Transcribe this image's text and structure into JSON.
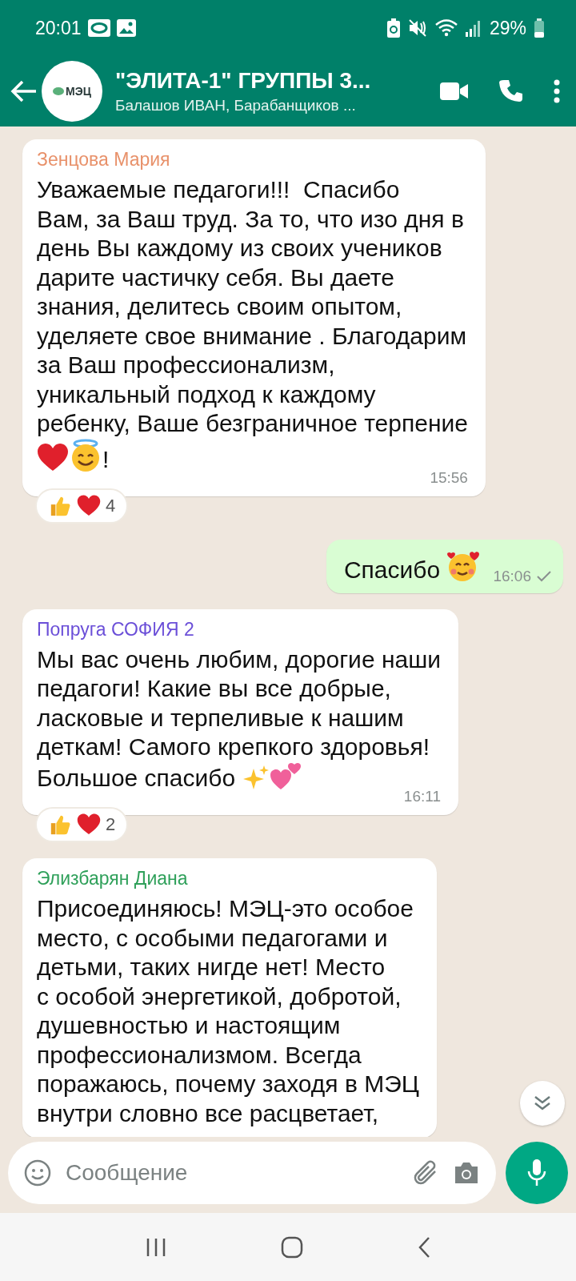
{
  "status_bar": {
    "time": "20:01",
    "battery": "29%"
  },
  "header": {
    "avatar_text": "МЭЦ",
    "title": "\"ЭЛИТА-1\" ГРУППЫ 3...",
    "subtitle": "Балашов ИВАН, Барабанщиков ..."
  },
  "messages": [
    {
      "kind": "incoming",
      "sender": "Зенцова Мария",
      "color": "#e8916a",
      "text": "Уважаемые педагоги!!!  Спасибо\nВам, за Ваш труд. За то, что изо дня в\nдень Вы каждому из своих учеников\nдарите частичку себя. Вы даете\nзнания, делитесь своим опытом,\nуделяете свое внимание . Благодарим\nза Ваш профессионализм,\nуникальный подход к каждому\nребенку, Ваше безграничное терпение",
      "emojis": [
        {
          "kind": "heart"
        },
        {
          "kind": "halo_smile"
        }
      ],
      "end_text": "!",
      "time": "15:56",
      "reactions": {
        "emojis": [
          {
            "kind": "thumbs_up"
          },
          {
            "kind": "heart"
          }
        ],
        "count": "4"
      }
    },
    {
      "kind": "outgoing",
      "last_line": "Спасибо",
      "emojis": [
        {
          "kind": "heart_face"
        }
      ],
      "time": "16:06",
      "sent": true
    },
    {
      "kind": "incoming",
      "sender": "Попруга СОФИЯ 2",
      "color": "#6b4fd8",
      "text": "Мы вас очень любим, дорогие наши\nпедагоги! Какие вы все добрые,\nласковые и терпеливые к нашим\nдеткам! Самого крепкого здоровья!",
      "last_line": "Большое спасибо",
      "emojis": [
        {
          "kind": "sparkles"
        },
        {
          "kind": "two_hearts"
        }
      ],
      "time": "16:11",
      "reactions": {
        "emojis": [
          {
            "kind": "thumbs_up"
          },
          {
            "kind": "heart"
          }
        ],
        "count": "2"
      }
    },
    {
      "kind": "incoming",
      "sender": "Элизбарян Диана",
      "color": "#2fa05a",
      "text": "Присоединяюсь! МЭЦ-это особое\nместо, с особыми педагогами и\nдетьми, таких нигде нет! Место\nс особой энергетикой, добротой,\nдушевностью и настоящим\nпрофессионализмом. Всегда\nпоражаюсь, почему заходя в МЭЦ\nвнутри словно все расцветает,"
    }
  ],
  "composer": {
    "placeholder": "Сообщение"
  }
}
